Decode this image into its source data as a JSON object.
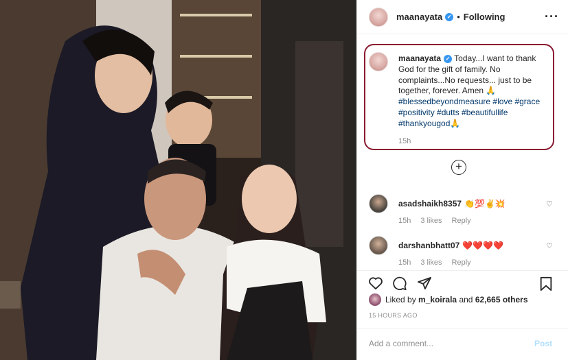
{
  "post": {
    "author": "maanayata",
    "verified_mark": "✓",
    "separator": "•",
    "follow_status": "Following",
    "more_label": "···"
  },
  "caption": {
    "author": "maanayata",
    "text": "Today...I want to thank God for the gift of family. No complaints...No requests... just to be together, forever. Amen 🙏",
    "hashtags": "#blessedbeyondmeasure #love #grace #positivity #dutts #beautifullife #thankyougod🙏",
    "time": "15h"
  },
  "expand_label": "+",
  "comments": [
    {
      "user": "asadshaikh8357",
      "text": "👏💯✌️💥",
      "time": "15h",
      "likes": "3 likes",
      "reply": "Reply",
      "heart": "♡"
    },
    {
      "user": "darshanbhatt07",
      "text": "❤️❤️❤️❤️",
      "time": "15h",
      "likes": "3 likes",
      "reply": "Reply",
      "heart": "♡"
    }
  ],
  "likes": {
    "prefix": "Liked by",
    "user": "m_koirala",
    "and": "and",
    "count": "62,665 others"
  },
  "timestamp": "15 HOURS AGO",
  "composer": {
    "placeholder": "Add a comment...",
    "post_label": "Post"
  },
  "icons": {
    "like": "heart-icon",
    "comment": "comment-icon",
    "share": "send-icon",
    "save": "bookmark-icon"
  },
  "colors": {
    "caption_highlight": "#8a1a30",
    "link": "#00376b",
    "verified": "#3897f0",
    "post_disabled": "#b2dffc"
  }
}
